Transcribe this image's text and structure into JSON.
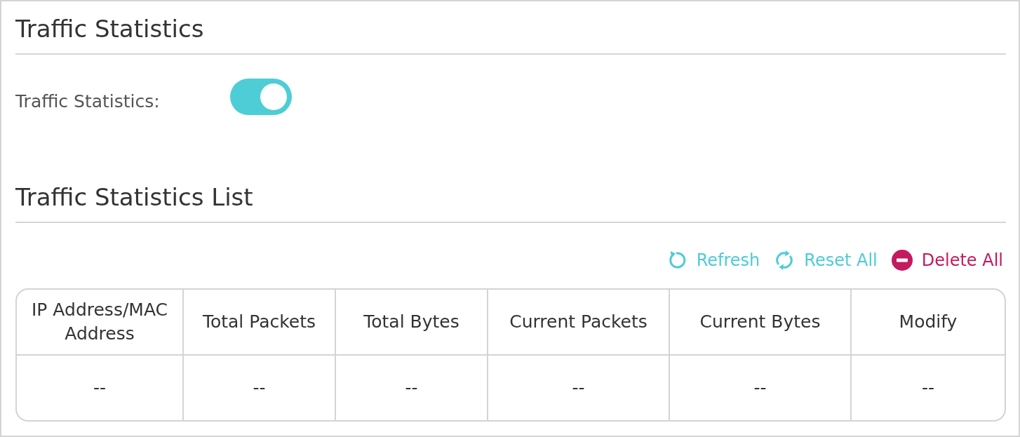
{
  "page_title": "Traffic Statistics",
  "settings": [
    {
      "label": "Traffic Statistics:",
      "kind": "toggle",
      "on": true
    }
  ],
  "list_title": "Traffic Statistics List",
  "toolbar": [
    {
      "label": "Refresh",
      "kind": "refresh"
    },
    {
      "label": "Reset All",
      "kind": "reset"
    },
    {
      "label": "Delete All",
      "kind": "delete"
    }
  ],
  "table": {
    "columns": [
      "IP Address/MAC Address",
      "Total Packets",
      "Total Bytes",
      "Current Packets",
      "Current Bytes",
      "Modify"
    ],
    "rows": [
      [
        "--",
        "--",
        "--",
        "--",
        "--",
        "--"
      ]
    ]
  }
}
